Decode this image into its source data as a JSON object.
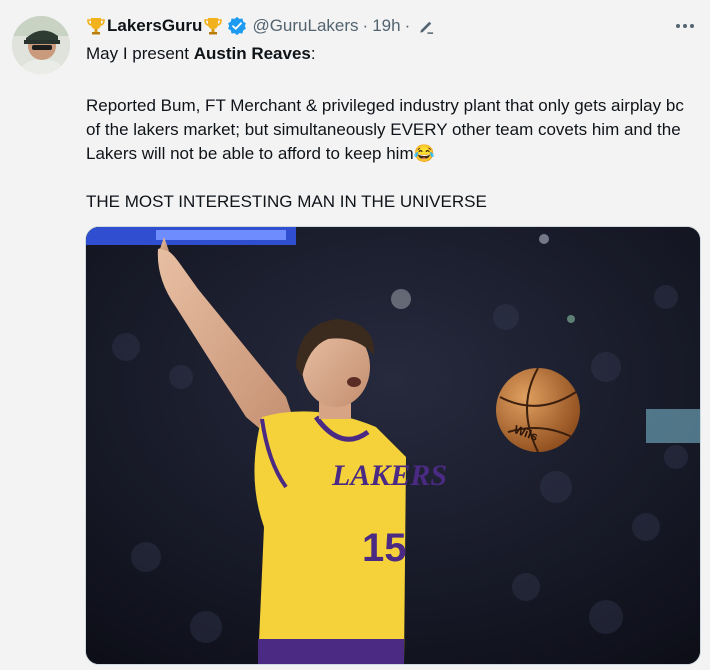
{
  "tweet": {
    "display_name": "LakersGuru",
    "handle": "@GuruLakers",
    "separator": "·",
    "time": "19h",
    "text_intro": "May I present ",
    "text_intro_bold": "Austin Reaves",
    "text_intro_end": ":",
    "paragraph": "Reported Bum, FT Merchant & privileged industry plant that only gets airplay bc of the lakers market; but simultaneously EVERY other team covets him and the Lakers will not be able to afford to keep him",
    "emoji": "😂",
    "closing": "THE MOST INTERESTING MAN IN THE UNIVERSE"
  },
  "media": {
    "jersey_text": "LAKERS",
    "jersey_number": "15",
    "ball_text": "Wils"
  },
  "icons": {
    "trophy": "trophy-icon",
    "verified": "verified-badge-icon",
    "edit": "edited-pencil-icon",
    "more": "more-options-icon"
  },
  "colors": {
    "verified_blue": "#1d9bf0",
    "jersey_gold": "#f6d23a",
    "jersey_purple": "#4b2a83"
  }
}
